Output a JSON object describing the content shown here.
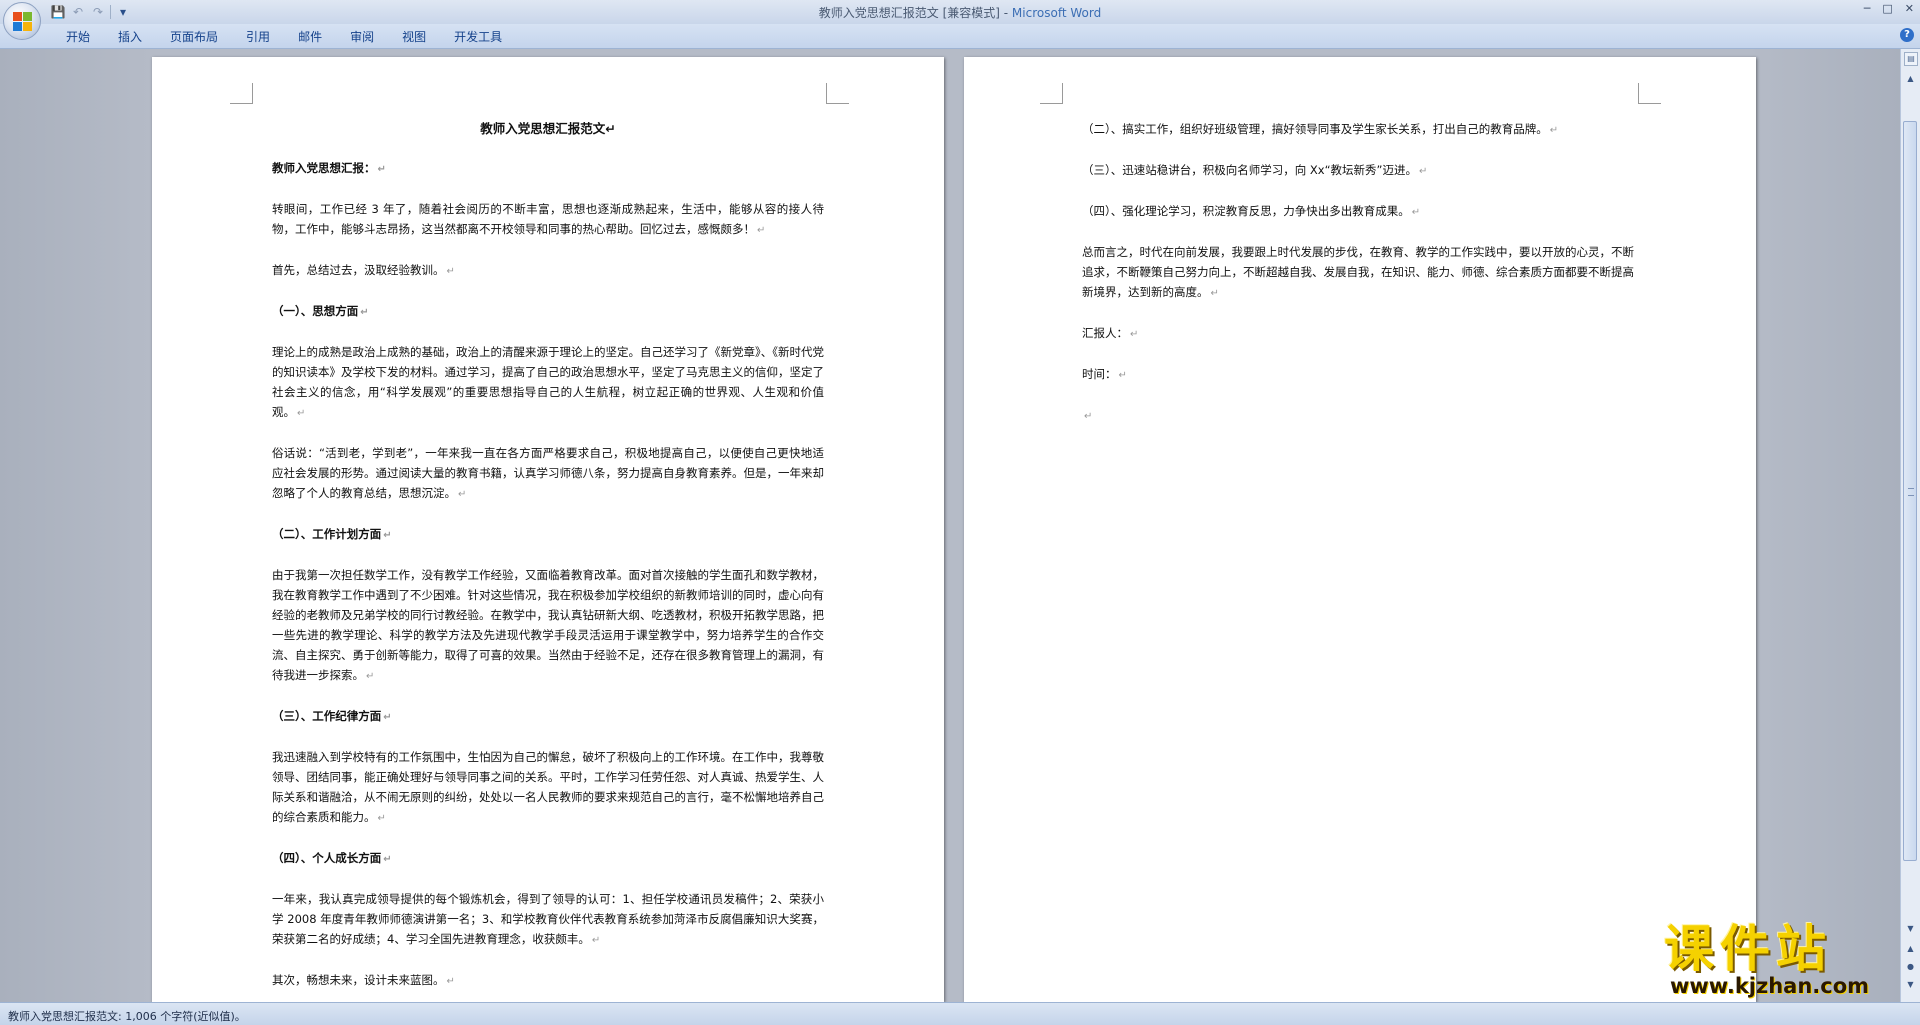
{
  "window": {
    "title_doc": "教师入党思想汇报范文 [兼容模式] - ",
    "title_app": "Microsoft Word"
  },
  "ribbon": {
    "tabs": [
      "开始",
      "插入",
      "页面布局",
      "引用",
      "邮件",
      "审阅",
      "视图",
      "开发工具"
    ]
  },
  "document": {
    "page1": {
      "title": "教师入党思想汇报范文",
      "paragraphs": [
        {
          "text": "教师入党思想汇报：",
          "bold": true
        },
        {
          "text": "转眼间，工作已经 3 年了，随着社会阅历的不断丰富，思想也逐渐成熟起来，生活中，能够从容的接人待物，工作中，能够斗志昂扬，这当然都离不开校领导和同事的热心帮助。回忆过去，感慨颇多！",
          "bold": false
        },
        {
          "text": "首先，总结过去，汲取经验教训。",
          "bold": false
        },
        {
          "text": "（一）、思想方面",
          "bold": true
        },
        {
          "text": "理论上的成熟是政治上成熟的基础，政治上的清醒来源于理论上的坚定。自己还学习了《新党章》、《新时代党的知识读本》及学校下发的材料。通过学习，提高了自己的政治思想水平，坚定了马克思主义的信仰，坚定了社会主义的信念，用“科学发展观”的重要思想指导自己的人生航程，树立起正确的世界观、人生观和价值观。",
          "bold": false
        },
        {
          "text": "俗话说：“活到老，学到老”，一年来我一直在各方面严格要求自己，积极地提高自己，以便使自己更快地适应社会发展的形势。通过阅读大量的教育书籍，认真学习师德八条，努力提高自身教育素养。但是，一年来却忽略了个人的教育总结，思想沉淀。",
          "bold": false
        },
        {
          "text": "（二）、工作计划方面",
          "bold": true
        },
        {
          "text": "由于我第一次担任数学工作，没有教学工作经验，又面临着教育改革。面对首次接触的学生面孔和数学教材，我在教育教学工作中遇到了不少困难。针对这些情况，我在积极参加学校组织的新教师培训的同时，虚心向有经验的老教师及兄弟学校的同行讨教经验。在教学中，我认真钻研新大纲、吃透教材，积极开拓教学思路，把一些先进的教学理论、科学的教学方法及先进现代教学手段灵活运用于课堂教学中，努力培养学生的合作交流、自主探究、勇于创新等能力，取得了可喜的效果。当然由于经验不足，还存在很多教育管理上的漏洞，有待我进一步探索。",
          "bold": false
        },
        {
          "text": "（三）、工作纪律方面",
          "bold": true
        },
        {
          "text": "我迅速融入到学校特有的工作氛围中，生怕因为自己的懈怠，破坏了积极向上的工作环境。在工作中，我尊敬领导、团结同事，能正确处理好与领导同事之间的关系。平时，工作学习任劳任怨、对人真诚、热爱学生、人际关系和谐融洽，从不闹无原则的纠纷，处处以一名人民教师的要求来规范自己的言行，毫不松懈地培养自己的综合素质和能力。",
          "bold": false
        },
        {
          "text": "（四）、个人成长方面",
          "bold": true
        },
        {
          "text": "一年来，我认真完成领导提供的每个锻炼机会，得到了领导的认可：1、担任学校通讯员发稿件；2、荣获小学 2008 年度青年教师师德演讲第一名；3、和学校教育伙伴代表教育系统参加菏泽市反腐倡廉知识大奖赛，荣获第二名的好成绩；4、学习全国先进教育理念，收获颇丰。",
          "bold": false
        },
        {
          "text": "其次，畅想未来，设计未来蓝图。",
          "bold": false
        }
      ]
    },
    "page2": {
      "paragraphs": [
        {
          "text": "（二）、搞实工作，组织好班级管理，搞好领导同事及学生家长关系，打出自己的教育品牌。",
          "bold": false
        },
        {
          "text": "（三）、迅速站稳讲台，积极向名师学习，向 Xx“教坛新秀”迈进。",
          "bold": false
        },
        {
          "text": "（四）、强化理论学习，积淀教育反思，力争快出多出教育成果。",
          "bold": false
        },
        {
          "text": "总而言之，时代在向前发展，我要跟上时代发展的步伐，在教育、教学的工作实践中，要以开放的心灵，不断追求，不断鞭策自己努力向上，不断超越自我、发展自我，在知识、能力、师德、综合素质方面都要不断提高新境界，达到新的高度。",
          "bold": false
        },
        {
          "text": "汇报人：",
          "bold": false
        },
        {
          "text": "时间：",
          "bold": false
        },
        {
          "text": "",
          "bold": false
        }
      ]
    }
  },
  "statusbar": {
    "text": "教师入党思想汇报范文: 1,006 个字符(近似值)。"
  },
  "watermark": {
    "title": "课件站",
    "url": "www.kjzhan.com"
  },
  "colors": {
    "ribbon_text": "#15428b",
    "title_app": "#3c6eb4",
    "watermark_yellow": "#f5d100"
  }
}
